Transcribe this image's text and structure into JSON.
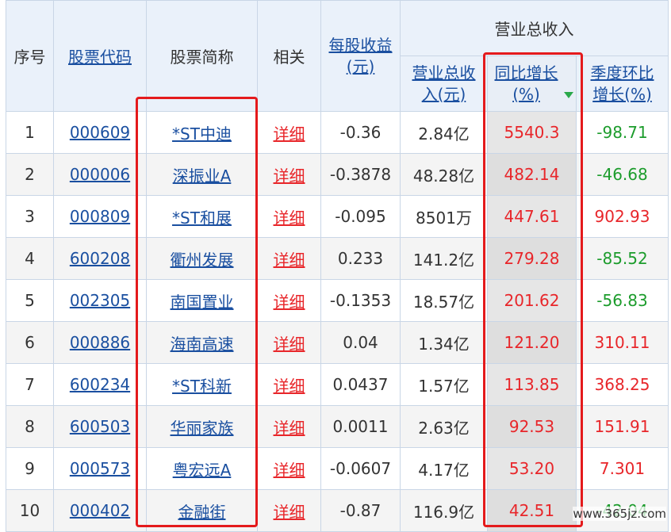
{
  "headers": {
    "seq": "序号",
    "code": "股票代码",
    "name": "股票简称",
    "related": "相关",
    "eps": "每股收益(元)",
    "group": "营业总收入",
    "revenue": "营业总收入(元)",
    "yoy": "同比增长(%)",
    "qoq": "季度环比增长(%)"
  },
  "rows": [
    {
      "seq": "1",
      "code": "000609",
      "name": "*ST中迪",
      "detail": "详细",
      "eps": "-0.36",
      "revenue": "2.84亿",
      "yoy": "5540.3",
      "qoq": "-98.71",
      "qoq_color": "green"
    },
    {
      "seq": "2",
      "code": "000006",
      "name": "深振业A",
      "detail": "详细",
      "eps": "-0.3878",
      "revenue": "48.28亿",
      "yoy": "482.14",
      "qoq": "-46.68",
      "qoq_color": "green"
    },
    {
      "seq": "3",
      "code": "000809",
      "name": "*ST和展",
      "detail": "详细",
      "eps": "-0.095",
      "revenue": "8501万",
      "yoy": "447.61",
      "qoq": "902.93",
      "qoq_color": "red"
    },
    {
      "seq": "4",
      "code": "600208",
      "name": "衢州发展",
      "detail": "详细",
      "eps": "0.233",
      "revenue": "141.2亿",
      "yoy": "279.28",
      "qoq": "-85.52",
      "qoq_color": "green"
    },
    {
      "seq": "5",
      "code": "002305",
      "name": "南国置业",
      "detail": "详细",
      "eps": "-0.1353",
      "revenue": "18.57亿",
      "yoy": "201.62",
      "qoq": "-56.83",
      "qoq_color": "green"
    },
    {
      "seq": "6",
      "code": "000886",
      "name": "海南高速",
      "detail": "详细",
      "eps": "0.04",
      "revenue": "1.34亿",
      "yoy": "121.20",
      "qoq": "310.11",
      "qoq_color": "red"
    },
    {
      "seq": "7",
      "code": "600234",
      "name": "*ST科新",
      "detail": "详细",
      "eps": "0.0437",
      "revenue": "1.57亿",
      "yoy": "113.85",
      "qoq": "368.25",
      "qoq_color": "red"
    },
    {
      "seq": "8",
      "code": "600503",
      "name": "华丽家族",
      "detail": "详细",
      "eps": "0.0011",
      "revenue": "2.63亿",
      "yoy": "92.53",
      "qoq": "151.91",
      "qoq_color": "red"
    },
    {
      "seq": "9",
      "code": "000573",
      "name": "粤宏远A",
      "detail": "详细",
      "eps": "-0.0607",
      "revenue": "4.17亿",
      "yoy": "53.20",
      "qoq": "7.301",
      "qoq_color": "red"
    },
    {
      "seq": "10",
      "code": "000402",
      "name": "金融街",
      "detail": "详细",
      "eps": "-0.87",
      "revenue": "116.9亿",
      "yoy": "42.51",
      "qoq": "-42.04",
      "qoq_color": "green"
    }
  ],
  "watermark": "www.365jz.com",
  "colors": {
    "positive": "#e8262a",
    "negative": "#1c9c2c",
    "highlight_box": "#e41a1c",
    "link": "#1a4fa0"
  }
}
